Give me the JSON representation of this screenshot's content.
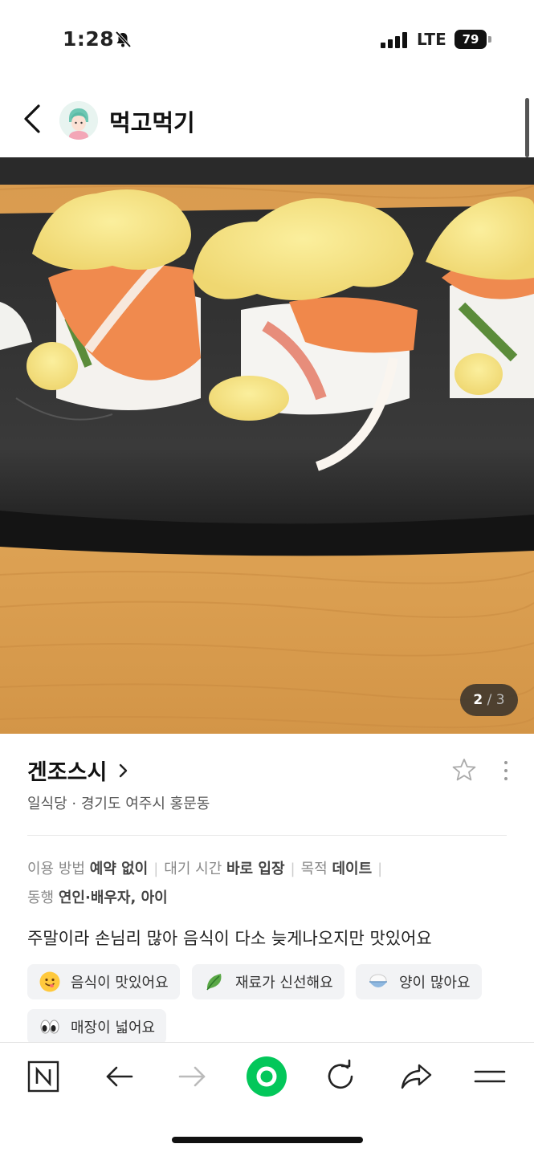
{
  "status_bar": {
    "time": "1:28",
    "network": "LTE",
    "battery": "79"
  },
  "header": {
    "title": "먹고먹기"
  },
  "photo": {
    "current": "2",
    "total": "/ 3"
  },
  "place": {
    "name": "겐조스시",
    "category_location": "일식당 · 경기도 여주시 홍문동"
  },
  "visit_info": [
    {
      "label": "이용 방법",
      "value": "예약 없이"
    },
    {
      "label": "대기 시간",
      "value": "바로 입장"
    },
    {
      "label": "목적",
      "value": "데이트"
    },
    {
      "label": "동행",
      "value": "연인·배우자, 아이"
    }
  ],
  "review_text": "주말이라 손님리 많아 음식이 다소 늦게나오지만 맛있어요",
  "keywords": [
    {
      "icon": "yum-face-icon",
      "label": "음식이 맛있어요"
    },
    {
      "icon": "leaf-icon",
      "label": "재료가 신선해요"
    },
    {
      "icon": "rice-bowl-icon",
      "label": "양이 많아요"
    },
    {
      "icon": "eyes-icon",
      "label": "매장이 넓어요"
    }
  ],
  "colors": {
    "accent": "#03c75a",
    "text": "#222222",
    "muted": "#888888"
  }
}
